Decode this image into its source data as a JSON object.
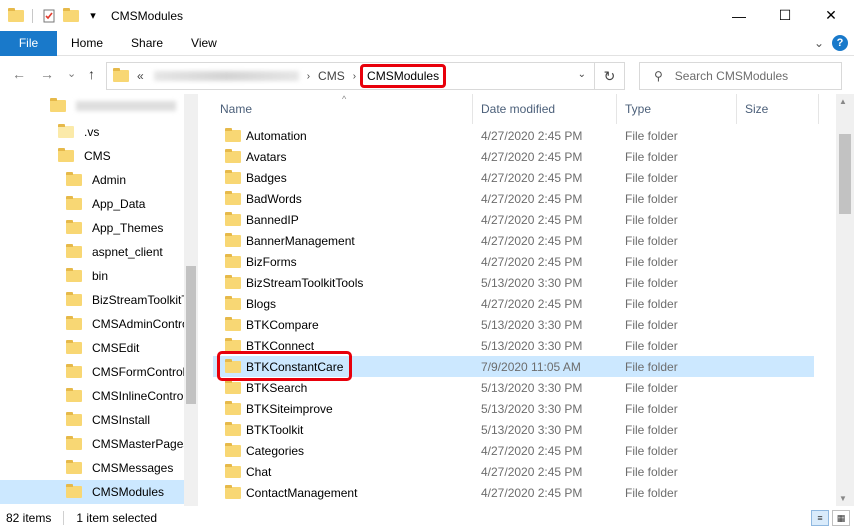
{
  "window": {
    "title": "CMSModules",
    "minimize": "—",
    "maximize": "☐",
    "close": "✕"
  },
  "ribbon": {
    "tabs": [
      "File",
      "Home",
      "Share",
      "View"
    ]
  },
  "address": {
    "prefix": "«",
    "crumbs": [
      "CMS",
      "CMSModules"
    ],
    "separator": "›"
  },
  "search": {
    "placeholder": "Search CMSModules"
  },
  "columns": {
    "name": "Name",
    "date": "Date modified",
    "type": "Type",
    "size": "Size"
  },
  "navpane": [
    {
      "label": ".vs",
      "indent": 1
    },
    {
      "label": "CMS",
      "indent": 1
    },
    {
      "label": "Admin",
      "indent": 2
    },
    {
      "label": "App_Data",
      "indent": 2
    },
    {
      "label": "App_Themes",
      "indent": 2
    },
    {
      "label": "aspnet_client",
      "indent": 2
    },
    {
      "label": "bin",
      "indent": 2
    },
    {
      "label": "BizStreamToolkitTo",
      "indent": 2
    },
    {
      "label": "CMSAdminContro",
      "indent": 2
    },
    {
      "label": "CMSEdit",
      "indent": 2
    },
    {
      "label": "CMSFormControls",
      "indent": 2
    },
    {
      "label": "CMSInlineControls",
      "indent": 2
    },
    {
      "label": "CMSInstall",
      "indent": 2
    },
    {
      "label": "CMSMasterPages",
      "indent": 2
    },
    {
      "label": "CMSMessages",
      "indent": 2
    },
    {
      "label": "CMSModules",
      "indent": 2,
      "selected": true
    }
  ],
  "files": [
    {
      "name": "Automation",
      "date": "4/27/2020 2:45 PM",
      "type": "File folder"
    },
    {
      "name": "Avatars",
      "date": "4/27/2020 2:45 PM",
      "type": "File folder"
    },
    {
      "name": "Badges",
      "date": "4/27/2020 2:45 PM",
      "type": "File folder"
    },
    {
      "name": "BadWords",
      "date": "4/27/2020 2:45 PM",
      "type": "File folder"
    },
    {
      "name": "BannedIP",
      "date": "4/27/2020 2:45 PM",
      "type": "File folder"
    },
    {
      "name": "BannerManagement",
      "date": "4/27/2020 2:45 PM",
      "type": "File folder"
    },
    {
      "name": "BizForms",
      "date": "4/27/2020 2:45 PM",
      "type": "File folder"
    },
    {
      "name": "BizStreamToolkitTools",
      "date": "5/13/2020 3:30 PM",
      "type": "File folder"
    },
    {
      "name": "Blogs",
      "date": "4/27/2020 2:45 PM",
      "type": "File folder"
    },
    {
      "name": "BTKCompare",
      "date": "5/13/2020 3:30 PM",
      "type": "File folder"
    },
    {
      "name": "BTKConnect",
      "date": "5/13/2020 3:30 PM",
      "type": "File folder"
    },
    {
      "name": "BTKConstantCare",
      "date": "7/9/2020 11:05 AM",
      "type": "File folder",
      "selected": true
    },
    {
      "name": "BTKSearch",
      "date": "5/13/2020 3:30 PM",
      "type": "File folder"
    },
    {
      "name": "BTKSiteimprove",
      "date": "5/13/2020 3:30 PM",
      "type": "File folder"
    },
    {
      "name": "BTKToolkit",
      "date": "5/13/2020 3:30 PM",
      "type": "File folder"
    },
    {
      "name": "Categories",
      "date": "4/27/2020 2:45 PM",
      "type": "File folder"
    },
    {
      "name": "Chat",
      "date": "4/27/2020 2:45 PM",
      "type": "File folder"
    },
    {
      "name": "ContactManagement",
      "date": "4/27/2020 2:45 PM",
      "type": "File folder"
    }
  ],
  "status": {
    "count": "82 items",
    "selection": "1 item selected"
  },
  "icons": {
    "back": "←",
    "forward": "→",
    "recent": "⌄",
    "up": "↑",
    "refresh": "↻",
    "search": "⚲",
    "dropdown": "⌄",
    "ribbon_expand": "⌄",
    "help": "?",
    "sort": "^"
  }
}
